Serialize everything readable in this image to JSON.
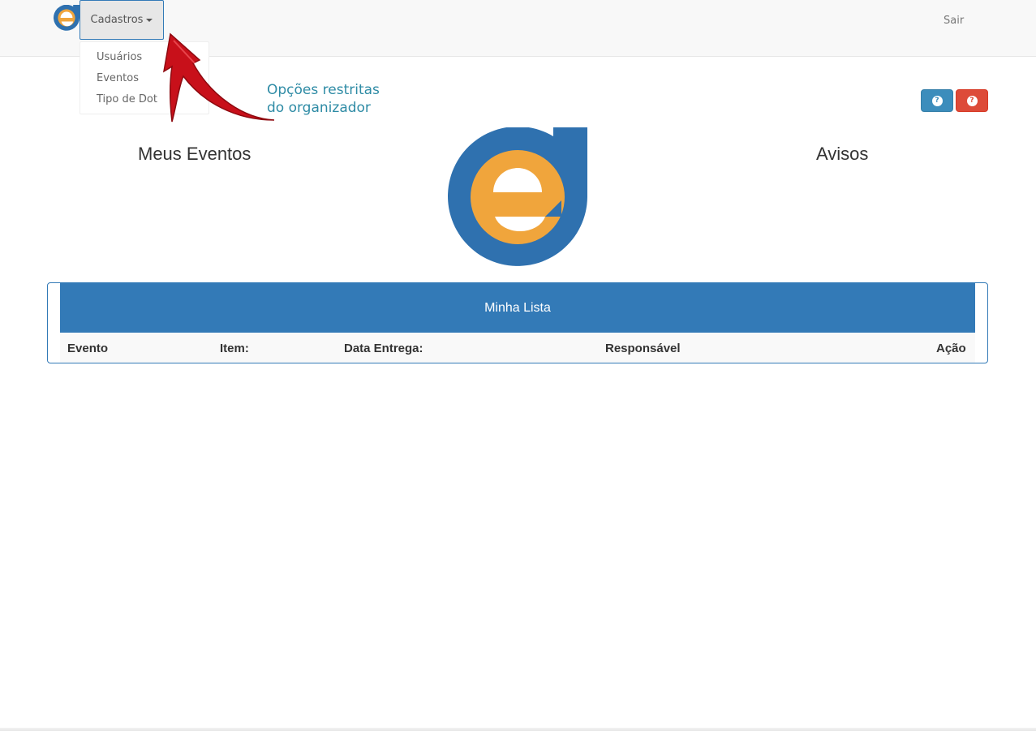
{
  "navbar": {
    "menu_label": "Cadastros",
    "menu_items": [
      "Usuários",
      "Eventos",
      "Tipo de Dot"
    ],
    "logout_label": "Sair"
  },
  "annotation": {
    "line1": "Opções restritas",
    "line2": "do organizador"
  },
  "sections": {
    "left_title": "Meus Eventos",
    "right_title": "Avisos"
  },
  "help_buttons": [
    {
      "icon": "question-circle-icon",
      "color": "#3c8dbc"
    },
    {
      "icon": "question-circle-icon",
      "color": "#dd4b39"
    }
  ],
  "list_panel": {
    "title": "Minha Lista",
    "columns": [
      "Evento",
      "Item:",
      "Data Entrega:",
      "Responsável",
      "Ação"
    ]
  },
  "colors": {
    "logo_blue": "#2f71af",
    "logo_orange": "#f0a53c",
    "panel_blue": "#337ab7",
    "annotation_teal": "#2e8ba5"
  }
}
